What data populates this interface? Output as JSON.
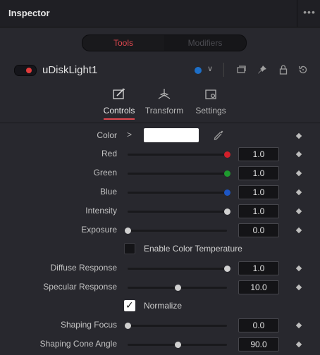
{
  "header": {
    "title": "Inspector",
    "more": "•••"
  },
  "tabs": {
    "active": "Tools",
    "inactive": "Modifiers"
  },
  "node": {
    "name": "uDiskLight1",
    "chevron": "∨"
  },
  "subtabs": [
    {
      "label": "Controls"
    },
    {
      "label": "Transform"
    },
    {
      "label": "Settings"
    }
  ],
  "controls": {
    "color": {
      "label": "Color",
      "arrow": ">"
    },
    "red": {
      "label": "Red",
      "value": "1.0",
      "level": 1.0,
      "knob_color": "#d21f2a"
    },
    "green": {
      "label": "Green",
      "value": "1.0",
      "level": 1.0,
      "knob_color": "#1e9a2e"
    },
    "blue": {
      "label": "Blue",
      "value": "1.0",
      "level": 1.0,
      "knob_color": "#1d56c4"
    },
    "intensity": {
      "label": "Intensity",
      "value": "1.0",
      "level": 1.0
    },
    "exposure": {
      "label": "Exposure",
      "value": "0.0",
      "level": 0.0
    },
    "enable_color_temp": {
      "label": "Enable Color Temperature",
      "checked": false
    },
    "diffuse": {
      "label": "Diffuse Response",
      "value": "1.0",
      "level": 1.0
    },
    "specular": {
      "label": "Specular Response",
      "value": "10.0",
      "level": 0.5
    },
    "normalize": {
      "label": "Normalize",
      "checked": true
    },
    "shaping_focus": {
      "label": "Shaping Focus",
      "value": "0.0",
      "level": 0.0
    },
    "shaping_cone": {
      "label": "Shaping Cone Angle",
      "value": "90.0",
      "level": 0.5
    }
  }
}
